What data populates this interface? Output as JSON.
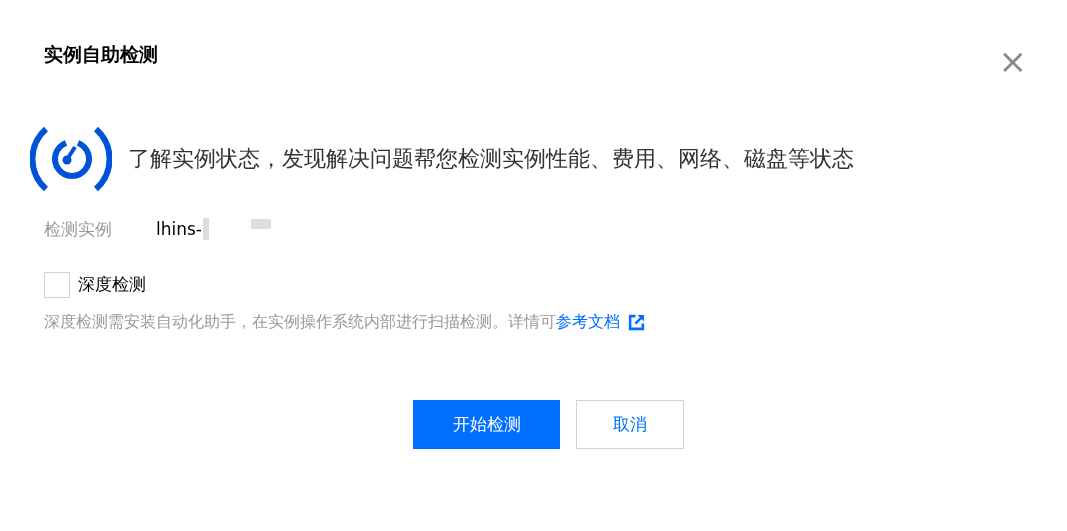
{
  "dialog": {
    "title": "实例自助检测",
    "close": "×"
  },
  "intro": "了解实例状态，发现解决问题帮您检测实例性能、费用、网络、磁盘等状态",
  "instance": {
    "label": "检测实例",
    "value": "lhins-"
  },
  "deep_check": {
    "label": "深度检测",
    "checked": false
  },
  "hint": {
    "text": "深度检测需安装自动化助手，在实例操作系统内部进行扫描检测。详情可",
    "link": "参考文档"
  },
  "buttons": [
    {
      "label": "开始检测",
      "kind": "primary"
    },
    {
      "label": "取消",
      "kind": "secondary"
    }
  ]
}
